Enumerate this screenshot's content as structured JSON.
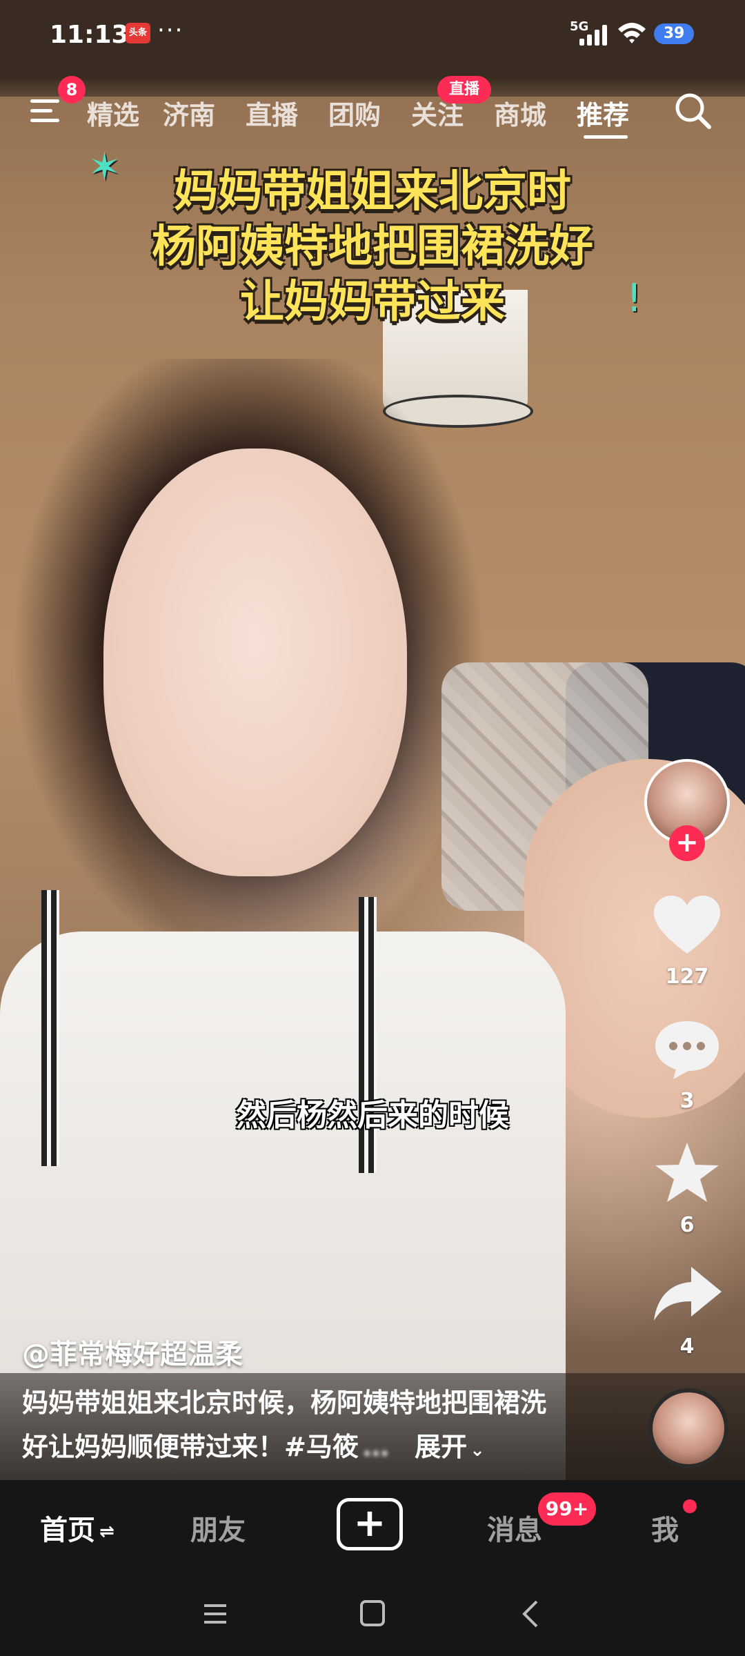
{
  "status_bar": {
    "time": "11:13",
    "app_badge": "头条",
    "more": "···",
    "signal": "5G",
    "battery": "39"
  },
  "top_nav": {
    "menu_badge": "8",
    "tabs": [
      {
        "label": "精选"
      },
      {
        "label": "济南"
      },
      {
        "label": "直播"
      },
      {
        "label": "团购"
      },
      {
        "label": "关注"
      },
      {
        "label": "商城"
      },
      {
        "label": "推荐"
      }
    ],
    "follow_live_badge": "直播",
    "active_tab": "推荐"
  },
  "headline": {
    "line1": "妈妈带姐姐来北京时",
    "line2": "杨阿姨特地把围裙洗好",
    "line3": "让妈妈带过来"
  },
  "subtitle": "然后杨然后来的时候",
  "right_rail": {
    "follow_plus": "+",
    "like_count": "127",
    "comment_count": "3",
    "favorite_count": "6",
    "share_count": "4"
  },
  "caption": {
    "author": "@菲常梅好超温柔",
    "line1": "妈妈带姐姐来北京时候，杨阿姨特地把围裙洗",
    "line2": "好让妈妈顺便带过来！#马筱",
    "line2_blurred": "…",
    "expand": "展开"
  },
  "bottom_tabs": {
    "home": "首页",
    "friends": "朋友",
    "create": "+",
    "messages": "消息",
    "messages_badge": "99+",
    "me": "我"
  },
  "colors": {
    "accent": "#fe2c55",
    "headline": "#ffe45a",
    "battery": "#3f7df0"
  }
}
